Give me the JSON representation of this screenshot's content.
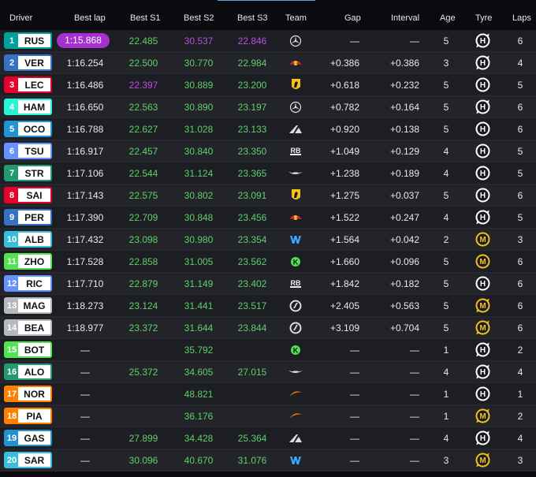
{
  "headers": {
    "driver": "Driver",
    "best_lap": "Best lap",
    "best_s1": "Best S1",
    "best_s2": "Best S2",
    "best_s3": "Best S3",
    "team": "Team",
    "gap": "Gap",
    "interval": "Interval",
    "age": "Age",
    "tyre": "Tyre",
    "laps": "Laps"
  },
  "rows": [
    {
      "pos": "1",
      "code": "RUS",
      "color": "#00a19c",
      "lap": "1:15.868",
      "lap_best": true,
      "s1": "22.485",
      "s1c": "green",
      "s2": "30.537",
      "s2c": "purple",
      "s3": "22.846",
      "s3c": "purple",
      "team": "mercedes",
      "gap": "—",
      "interval": "—",
      "age": "5",
      "tyre": "H",
      "tyre_new": false,
      "laps": "6"
    },
    {
      "pos": "2",
      "code": "VER",
      "color": "#3671c6",
      "lap": "1:16.254",
      "s1": "22.500",
      "s1c": "green",
      "s2": "30.770",
      "s2c": "green",
      "s3": "22.984",
      "s3c": "green",
      "team": "redbull",
      "gap": "+0.386",
      "interval": "+0.386",
      "age": "3",
      "tyre": "H",
      "tyre_new": false,
      "laps": "4"
    },
    {
      "pos": "3",
      "code": "LEC",
      "color": "#e8002d",
      "lap": "1:16.486",
      "s1": "22.397",
      "s1c": "purple",
      "s2": "30.889",
      "s2c": "green",
      "s3": "23.200",
      "s3c": "green",
      "team": "ferrari",
      "gap": "+0.618",
      "interval": "+0.232",
      "age": "5",
      "tyre": "H",
      "tyre_new": true,
      "laps": "5"
    },
    {
      "pos": "4",
      "code": "HAM",
      "color": "#27f4d2",
      "lap": "1:16.650",
      "s1": "22.563",
      "s1c": "green",
      "s2": "30.890",
      "s2c": "green",
      "s3": "23.197",
      "s3c": "green",
      "team": "mercedes",
      "gap": "+0.782",
      "interval": "+0.164",
      "age": "5",
      "tyre": "H",
      "tyre_new": false,
      "laps": "6"
    },
    {
      "pos": "5",
      "code": "OCO",
      "color": "#2293d1",
      "lap": "1:16.788",
      "s1": "22.627",
      "s1c": "green",
      "s2": "31.028",
      "s2c": "green",
      "s3": "23.133",
      "s3c": "green",
      "team": "alpine",
      "gap": "+0.920",
      "interval": "+0.138",
      "age": "5",
      "tyre": "H",
      "tyre_new": true,
      "laps": "6"
    },
    {
      "pos": "6",
      "code": "TSU",
      "color": "#6692ff",
      "lap": "1:16.917",
      "s1": "22.457",
      "s1c": "green",
      "s2": "30.840",
      "s2c": "green",
      "s3": "23.350",
      "s3c": "green",
      "team": "rb",
      "gap": "+1.049",
      "interval": "+0.129",
      "age": "4",
      "tyre": "H",
      "tyre_new": true,
      "laps": "5"
    },
    {
      "pos": "7",
      "code": "STR",
      "color": "#229971",
      "lap": "1:17.106",
      "s1": "22.544",
      "s1c": "green",
      "s2": "31.124",
      "s2c": "green",
      "s3": "23.365",
      "s3c": "green",
      "team": "astonmartin",
      "gap": "+1.238",
      "interval": "+0.189",
      "age": "4",
      "tyre": "H",
      "tyre_new": true,
      "laps": "5"
    },
    {
      "pos": "8",
      "code": "SAI",
      "color": "#e8002d",
      "lap": "1:17.143",
      "s1": "22.575",
      "s1c": "green",
      "s2": "30.802",
      "s2c": "green",
      "s3": "23.091",
      "s3c": "green",
      "team": "ferrari",
      "gap": "+1.275",
      "interval": "+0.037",
      "age": "5",
      "tyre": "H",
      "tyre_new": true,
      "laps": "6"
    },
    {
      "pos": "9",
      "code": "PER",
      "color": "#3671c6",
      "lap": "1:17.390",
      "s1": "22.709",
      "s1c": "green",
      "s2": "30.848",
      "s2c": "green",
      "s3": "23.456",
      "s3c": "green",
      "team": "redbull",
      "gap": "+1.522",
      "interval": "+0.247",
      "age": "4",
      "tyre": "H",
      "tyre_new": false,
      "laps": "5"
    },
    {
      "pos": "10",
      "code": "ALB",
      "color": "#37bedd",
      "lap": "1:17.432",
      "s1": "23.098",
      "s1c": "green",
      "s2": "30.980",
      "s2c": "green",
      "s3": "23.354",
      "s3c": "green",
      "team": "williams",
      "gap": "+1.564",
      "interval": "+0.042",
      "age": "2",
      "tyre": "M",
      "tyre_new": true,
      "laps": "3"
    },
    {
      "pos": "11",
      "code": "ZHO",
      "color": "#52e252",
      "lap": "1:17.528",
      "s1": "22.858",
      "s1c": "green",
      "s2": "31.005",
      "s2c": "green",
      "s3": "23.562",
      "s3c": "green",
      "team": "kick",
      "gap": "+1.660",
      "interval": "+0.096",
      "age": "5",
      "tyre": "M",
      "tyre_new": true,
      "laps": "6"
    },
    {
      "pos": "12",
      "code": "RIC",
      "color": "#6692ff",
      "lap": "1:17.710",
      "s1": "22.879",
      "s1c": "green",
      "s2": "31.149",
      "s2c": "green",
      "s3": "23.402",
      "s3c": "green",
      "team": "rb",
      "gap": "+1.842",
      "interval": "+0.182",
      "age": "5",
      "tyre": "H",
      "tyre_new": true,
      "laps": "6"
    },
    {
      "pos": "13",
      "code": "MAG",
      "color": "#b6babd",
      "lap": "1:18.273",
      "s1": "23.124",
      "s1c": "green",
      "s2": "31.441",
      "s2c": "green",
      "s3": "23.517",
      "s3c": "green",
      "team": "haas",
      "gap": "+2.405",
      "interval": "+0.563",
      "age": "5",
      "tyre": "M",
      "tyre_new": false,
      "laps": "6"
    },
    {
      "pos": "14",
      "code": "BEA",
      "color": "#b6babd",
      "lap": "1:18.977",
      "s1": "23.372",
      "s1c": "green",
      "s2": "31.644",
      "s2c": "green",
      "s3": "23.844",
      "s3c": "green",
      "team": "haas",
      "gap": "+3.109",
      "interval": "+0.704",
      "age": "5",
      "tyre": "M",
      "tyre_new": false,
      "laps": "6"
    },
    {
      "pos": "15",
      "code": "BOT",
      "color": "#52e252",
      "lap": "—",
      "s1": "",
      "s1c": "green",
      "s2": "35.792",
      "s2c": "green",
      "s3": "",
      "s3c": "green",
      "team": "kick",
      "gap": "—",
      "interval": "—",
      "age": "1",
      "tyre": "H",
      "tyre_new": false,
      "laps": "2"
    },
    {
      "pos": "16",
      "code": "ALO",
      "color": "#229971",
      "lap": "—",
      "s1": "25.372",
      "s1c": "green",
      "s2": "34.605",
      "s2c": "green",
      "s3": "27.015",
      "s3c": "green",
      "team": "astonmartin",
      "gap": "—",
      "interval": "—",
      "age": "4",
      "tyre": "H",
      "tyre_new": false,
      "laps": "4"
    },
    {
      "pos": "17",
      "code": "NOR",
      "color": "#ff8000",
      "lap": "—",
      "s1": "",
      "s1c": "green",
      "s2": "48.821",
      "s2c": "green",
      "s3": "",
      "s3c": "green",
      "team": "mclaren",
      "gap": "—",
      "interval": "—",
      "age": "1",
      "tyre": "H",
      "tyre_new": true,
      "laps": "1"
    },
    {
      "pos": "18",
      "code": "PIA",
      "color": "#ff8000",
      "lap": "—",
      "s1": "",
      "s1c": "green",
      "s2": "36.176",
      "s2c": "green",
      "s3": "",
      "s3c": "green",
      "team": "mclaren",
      "gap": "—",
      "interval": "—",
      "age": "1",
      "tyre": "M",
      "tyre_new": false,
      "laps": "2"
    },
    {
      "pos": "19",
      "code": "GAS",
      "color": "#2293d1",
      "lap": "—",
      "s1": "27.899",
      "s1c": "green",
      "s2": "34.428",
      "s2c": "green",
      "s3": "25.364",
      "s3c": "green",
      "team": "alpine",
      "gap": "—",
      "interval": "—",
      "age": "4",
      "tyre": "H",
      "tyre_new": false,
      "laps": "4"
    },
    {
      "pos": "20",
      "code": "SAR",
      "color": "#37bedd",
      "lap": "—",
      "s1": "30.096",
      "s1c": "green",
      "s2": "40.670",
      "s2c": "green",
      "s3": "31.076",
      "s3c": "green",
      "team": "williams",
      "gap": "—",
      "interval": "—",
      "age": "3",
      "tyre": "M",
      "tyre_new": false,
      "laps": "3"
    }
  ],
  "team_icons": {
    "mercedes": "mercedes-star-icon",
    "redbull": "red-bull-icon",
    "ferrari": "ferrari-horse-icon",
    "alpine": "alpine-icon",
    "rb": "rb-icon",
    "astonmartin": "aston-martin-wings-icon",
    "williams": "williams-w-icon",
    "kick": "kick-sauber-icon",
    "haas": "haas-icon",
    "mclaren": "mclaren-swoosh-icon"
  },
  "colors": {
    "hard": "#ffffff",
    "medium": "#f2c21b",
    "sector_green": "#5fcf6a",
    "sector_purple": "#b84fe0",
    "fastest_lap": "#a52fcf"
  }
}
